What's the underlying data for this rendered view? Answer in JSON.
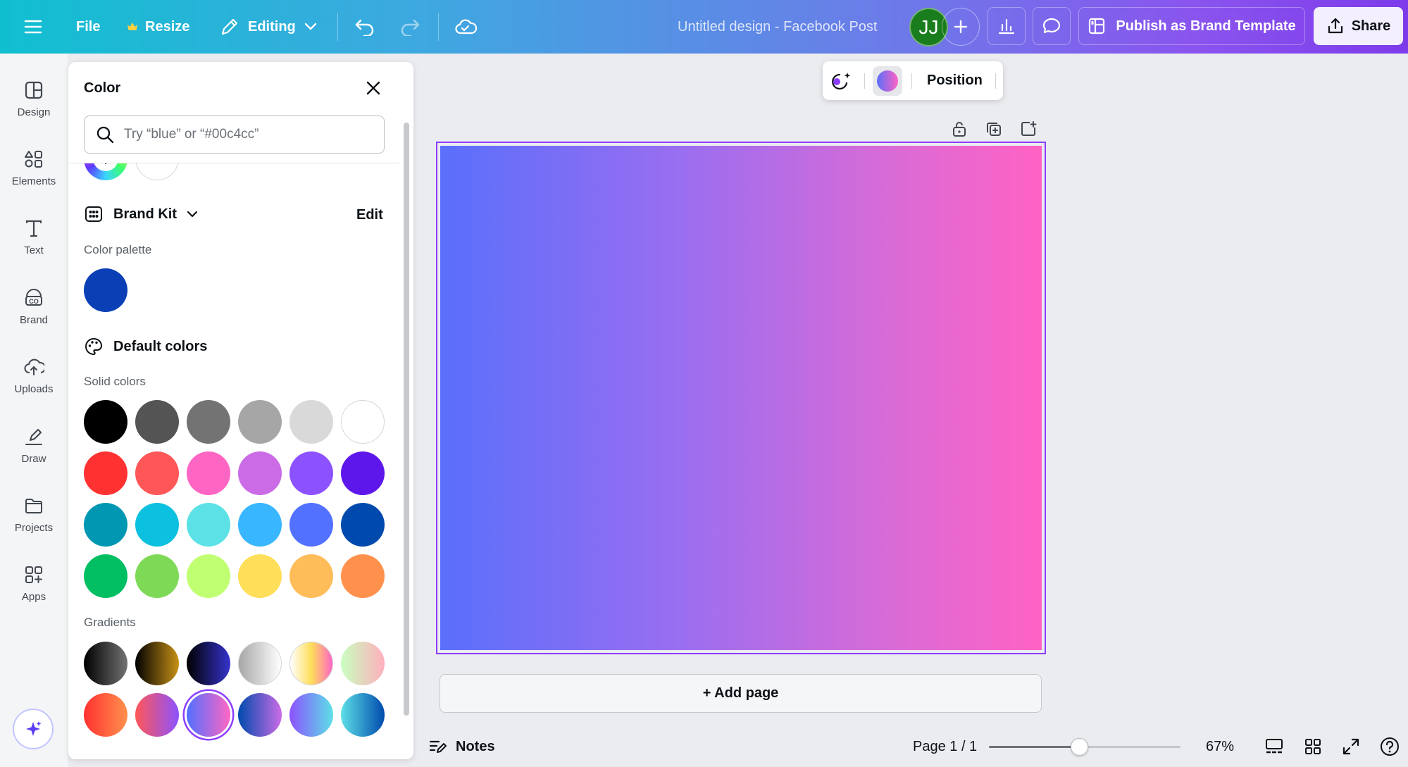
{
  "topbar": {
    "file_label": "File",
    "resize_label": "Resize",
    "editing_label": "Editing",
    "design_title": "Untitled design - Facebook Post",
    "avatar_initials": "JJ",
    "publish_label": "Publish as Brand Template",
    "share_label": "Share"
  },
  "rail": {
    "items": [
      {
        "label": "Design",
        "icon": "design-icon"
      },
      {
        "label": "Elements",
        "icon": "elements-icon"
      },
      {
        "label": "Text",
        "icon": "text-icon"
      },
      {
        "label": "Brand",
        "icon": "brand-icon"
      },
      {
        "label": "Uploads",
        "icon": "uploads-icon"
      },
      {
        "label": "Draw",
        "icon": "draw-icon"
      },
      {
        "label": "Projects",
        "icon": "projects-icon"
      },
      {
        "label": "Apps",
        "icon": "apps-icon"
      }
    ]
  },
  "color_panel": {
    "title": "Color",
    "search_placeholder": "Try “blue” or “#00c4cc”",
    "brand_kit_label": "Brand Kit",
    "edit_label": "Edit",
    "color_palette_label": "Color palette",
    "palette_colors": [
      "#0a3fb5"
    ],
    "default_colors_label": "Default colors",
    "solid_colors_label": "Solid colors",
    "solid_colors": [
      [
        "#000000",
        "#545454",
        "#737373",
        "#a6a6a6",
        "#d9d9d9",
        "#ffffff"
      ],
      [
        "#ff3131",
        "#ff5757",
        "#ff66c4",
        "#cb6ce6",
        "#8c52ff",
        "#5e17eb"
      ],
      [
        "#0097b2",
        "#0cc0df",
        "#5ce1e6",
        "#38b6ff",
        "#5271ff",
        "#004aad"
      ],
      [
        "#00bf63",
        "#7ed957",
        "#c1ff72",
        "#ffde59",
        "#ffbd59",
        "#ff914d"
      ]
    ],
    "gradients_label": "Gradients",
    "gradients": [
      [
        [
          "#000000",
          "#737373"
        ],
        [
          "#000000",
          "#c89116"
        ],
        [
          "#000000",
          "#3533cd"
        ],
        [
          "#a6a6a6",
          "#ffffff"
        ],
        [
          "#ffffff",
          "#ffde59",
          "#ff66c4"
        ],
        [
          "#c9ffbf",
          "#ffafbd"
        ]
      ],
      [
        [
          "#ff3131",
          "#ff914d"
        ],
        [
          "#ff5757",
          "#8c52ff"
        ],
        [
          "#5170ff",
          "#ff66c4"
        ],
        [
          "#004aad",
          "#cb6ce6"
        ],
        [
          "#8c52ff",
          "#5ce1e6"
        ],
        [
          "#5de0e6",
          "#004aad"
        ]
      ]
    ],
    "selected_gradient": [
      1,
      2
    ]
  },
  "canvas_toolbar": {
    "position_label": "Position"
  },
  "canvas": {
    "fill_colors": [
      "#5a6ffb",
      "#ff62c4"
    ],
    "add_page_label": "+ Add page"
  },
  "bottombar": {
    "notes_label": "Notes",
    "page_label": "Page 1 / 1",
    "zoom_label": "67%",
    "zoom_fraction": 0.47
  },
  "accent_color": "#8b3dff"
}
